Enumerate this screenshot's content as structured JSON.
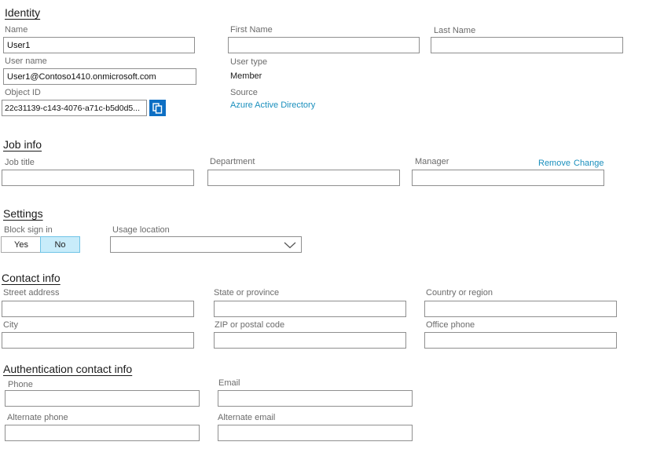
{
  "identity": {
    "title": "Identity",
    "name_label": "Name",
    "name_value": "User1",
    "first_name_label": "First Name",
    "first_name_value": "",
    "last_name_label": "Last Name",
    "last_name_value": "",
    "user_name_label": "User name",
    "user_name_value": "User1@Contoso1410.onmicrosoft.com",
    "user_type_label": "User type",
    "user_type_value": "Member",
    "object_id_label": "Object ID",
    "object_id_value": "22c31139-c143-4076-a71c-b5d0d5...",
    "source_label": "Source",
    "source_value": "Azure Active Directory",
    "copy_icon": "copy-icon"
  },
  "job_info": {
    "title": "Job info",
    "job_title_label": "Job title",
    "department_label": "Department",
    "manager_label": "Manager",
    "remove_label": "Remove",
    "change_label": "Change"
  },
  "settings": {
    "title": "Settings",
    "block_sign_in_label": "Block sign in",
    "yes_label": "Yes",
    "no_label": "No",
    "block_sign_in_selected": "No",
    "usage_location_label": "Usage location",
    "usage_location_value": "",
    "dropdown_icon": "chevron-down-icon"
  },
  "contact_info": {
    "title": "Contact info",
    "street_label": "Street address",
    "state_label": "State or province",
    "country_label": "Country or region",
    "city_label": "City",
    "zip_label": "ZIP or postal code",
    "office_phone_label": "Office phone"
  },
  "auth_contact": {
    "title": "Authentication contact info",
    "phone_label": "Phone",
    "email_label": "Email",
    "alt_phone_label": "Alternate phone",
    "alt_email_label": "Alternate email"
  },
  "colors": {
    "link": "#1a8fbd",
    "copy_button": "#0d6fc4",
    "toggle_selected": "#c8ecfa"
  }
}
